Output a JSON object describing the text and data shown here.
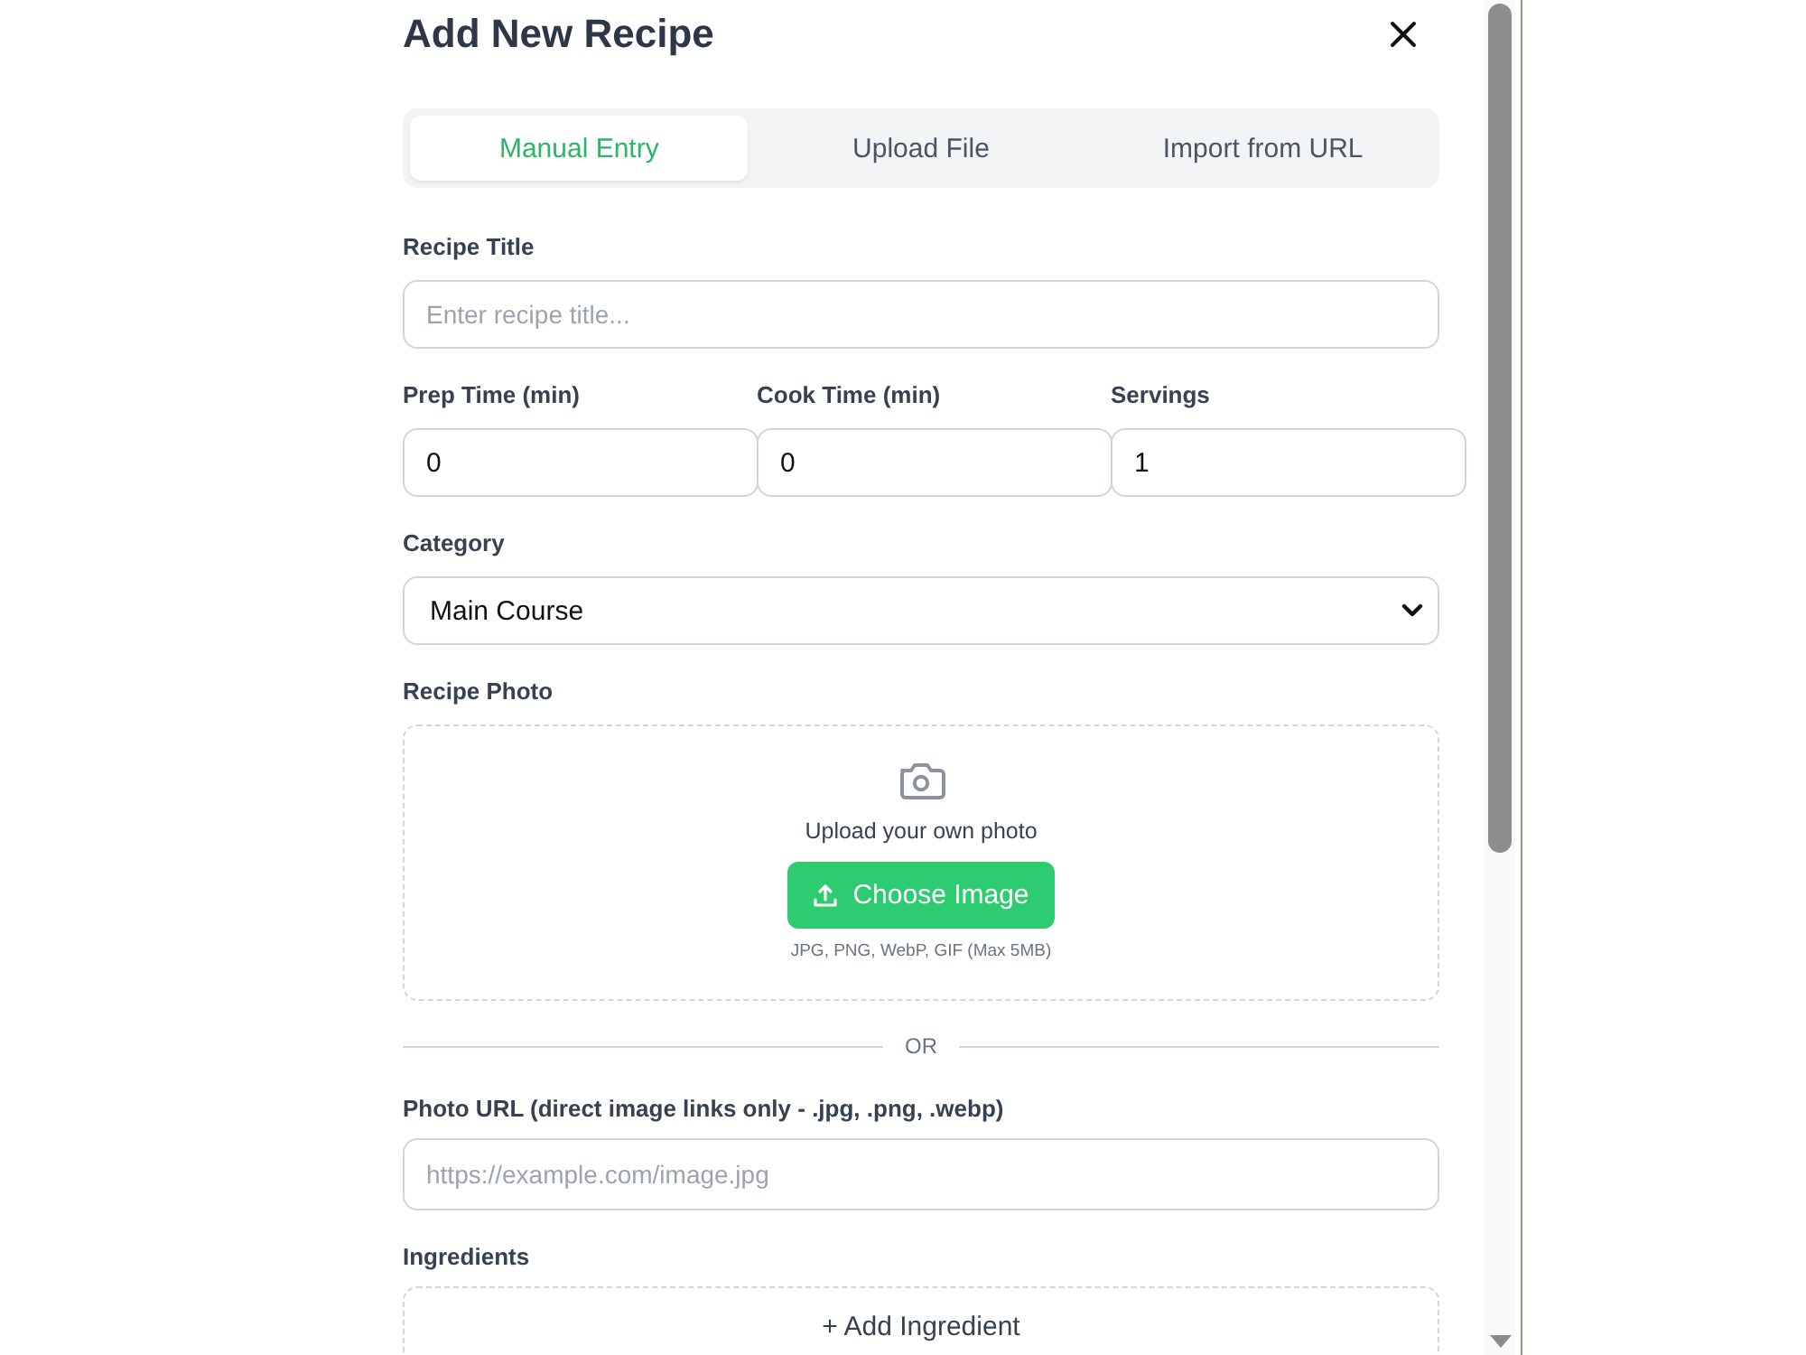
{
  "dialog": {
    "title": "Add New Recipe"
  },
  "tabs": [
    {
      "label": "Manual Entry",
      "selected": true
    },
    {
      "label": "Upload File",
      "selected": false
    },
    {
      "label": "Import from URL",
      "selected": false
    }
  ],
  "recipe_title": {
    "label": "Recipe Title",
    "placeholder": "Enter recipe title..."
  },
  "time_fields": [
    {
      "label": "Prep Time (min)",
      "value": "0"
    },
    {
      "label": "Cook Time (min)",
      "value": "0"
    },
    {
      "label": "Servings",
      "value": "1"
    }
  ],
  "category": {
    "label": "Category",
    "value": "Main Course"
  },
  "photo": {
    "label": "Recipe Photo",
    "upload_prompt": "Upload your own photo",
    "button": "Choose Image",
    "formats_hint": "JPG, PNG, WebP, GIF (Max 5MB)"
  },
  "divider": "OR",
  "photo_url": {
    "label": "Photo URL (direct image links only - .jpg, .png, .webp)",
    "placeholder": "https://example.com/image.jpg"
  },
  "ingredients": {
    "label": "Ingredients",
    "add_button": "+ Add Ingredient"
  }
}
